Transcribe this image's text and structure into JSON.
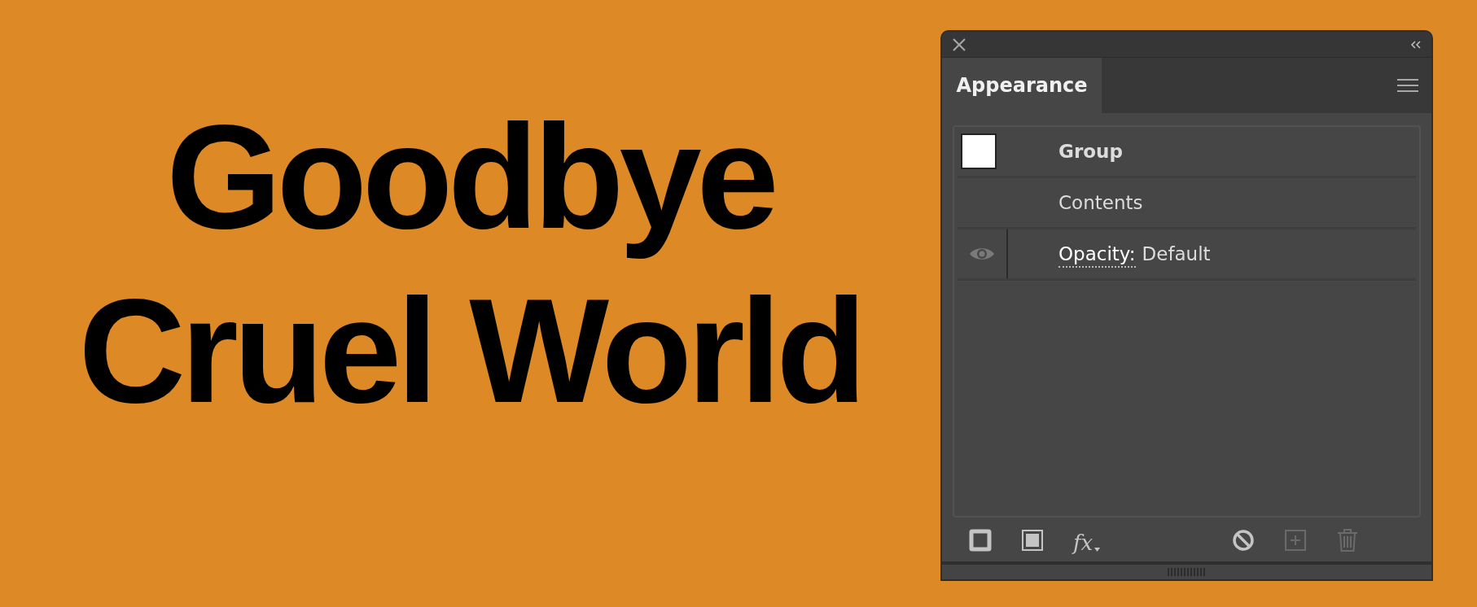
{
  "canvas": {
    "lines": [
      "Goodbye",
      "Cruel World"
    ]
  },
  "panel": {
    "tab": {
      "label": "Appearance",
      "selected": true
    },
    "rows": [
      {
        "kind": "object",
        "label": "Group"
      },
      {
        "kind": "contents",
        "label": "Contents"
      },
      {
        "kind": "attribute",
        "label": "Opacity:",
        "value": "Default",
        "visible": true
      }
    ],
    "toolbar": [
      {
        "kind": "stroke",
        "disabled": false
      },
      {
        "kind": "fill",
        "disabled": false
      },
      {
        "kind": "fx",
        "label": "fx",
        "disabled": false
      },
      {
        "kind": "clear",
        "disabled": false
      },
      {
        "kind": "duplicate",
        "disabled": true
      },
      {
        "kind": "delete",
        "disabled": true
      }
    ]
  }
}
